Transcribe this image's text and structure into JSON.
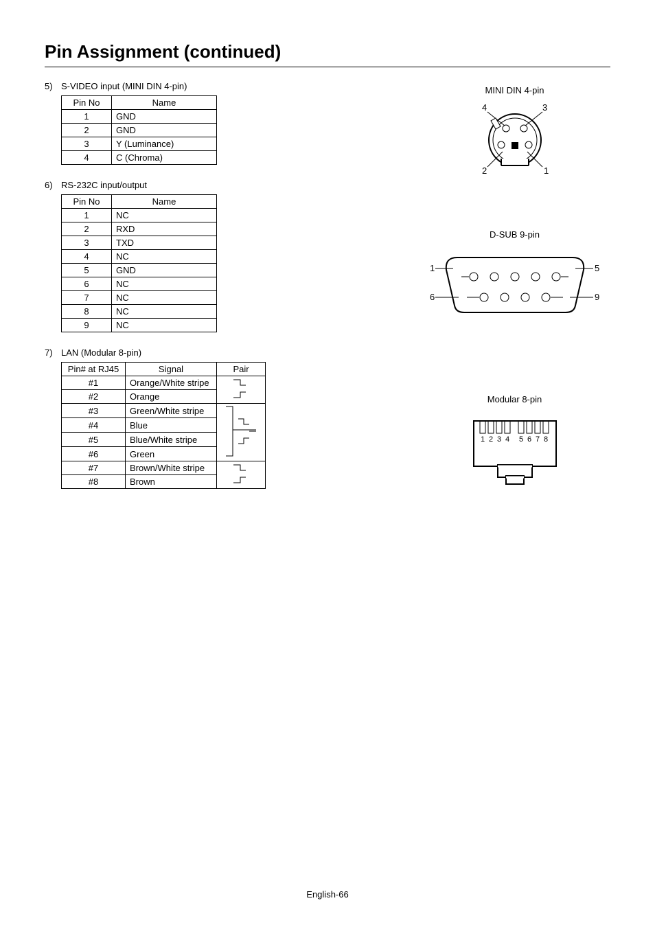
{
  "title": "Pin Assignment (continued)",
  "footer": "English-66",
  "section5": {
    "num": "5)",
    "heading": "S-VIDEO input (MINI DIN 4-pin)",
    "headers": [
      "Pin No",
      "Name"
    ],
    "rows": [
      [
        "1",
        "GND"
      ],
      [
        "2",
        "GND"
      ],
      [
        "3",
        "Y (Luminance)"
      ],
      [
        "4",
        "C (Chroma)"
      ]
    ]
  },
  "section6": {
    "num": "6)",
    "heading": "RS-232C input/output",
    "headers": [
      "Pin No",
      "Name"
    ],
    "rows": [
      [
        "1",
        "NC"
      ],
      [
        "2",
        "RXD"
      ],
      [
        "3",
        "TXD"
      ],
      [
        "4",
        "NC"
      ],
      [
        "5",
        "GND"
      ],
      [
        "6",
        "NC"
      ],
      [
        "7",
        "NC"
      ],
      [
        "8",
        "NC"
      ],
      [
        "9",
        "NC"
      ]
    ]
  },
  "section7": {
    "num": "7)",
    "heading": "LAN (Modular 8-pin)",
    "headers": [
      "Pin# at RJ45",
      "Signal",
      "Pair"
    ],
    "rows": [
      [
        "#1",
        "Orange/White stripe"
      ],
      [
        "#2",
        "Orange"
      ],
      [
        "#3",
        "Green/White stripe"
      ],
      [
        "#4",
        "Blue"
      ],
      [
        "#5",
        "Blue/White stripe"
      ],
      [
        "#6",
        "Green"
      ],
      [
        "#7",
        "Brown/White stripe"
      ],
      [
        "#8",
        "Brown"
      ]
    ]
  },
  "diagrams": {
    "d1": {
      "title": "MINI DIN 4-pin",
      "labels": [
        "4",
        "3",
        "2",
        "1"
      ]
    },
    "d2": {
      "title": "D-SUB 9-pin",
      "labels": [
        "1",
        "5",
        "6",
        "9"
      ]
    },
    "d3": {
      "title": "Modular 8-pin",
      "labels": [
        "1",
        "2",
        "3",
        "4",
        "5",
        "6",
        "7",
        "8"
      ]
    }
  }
}
